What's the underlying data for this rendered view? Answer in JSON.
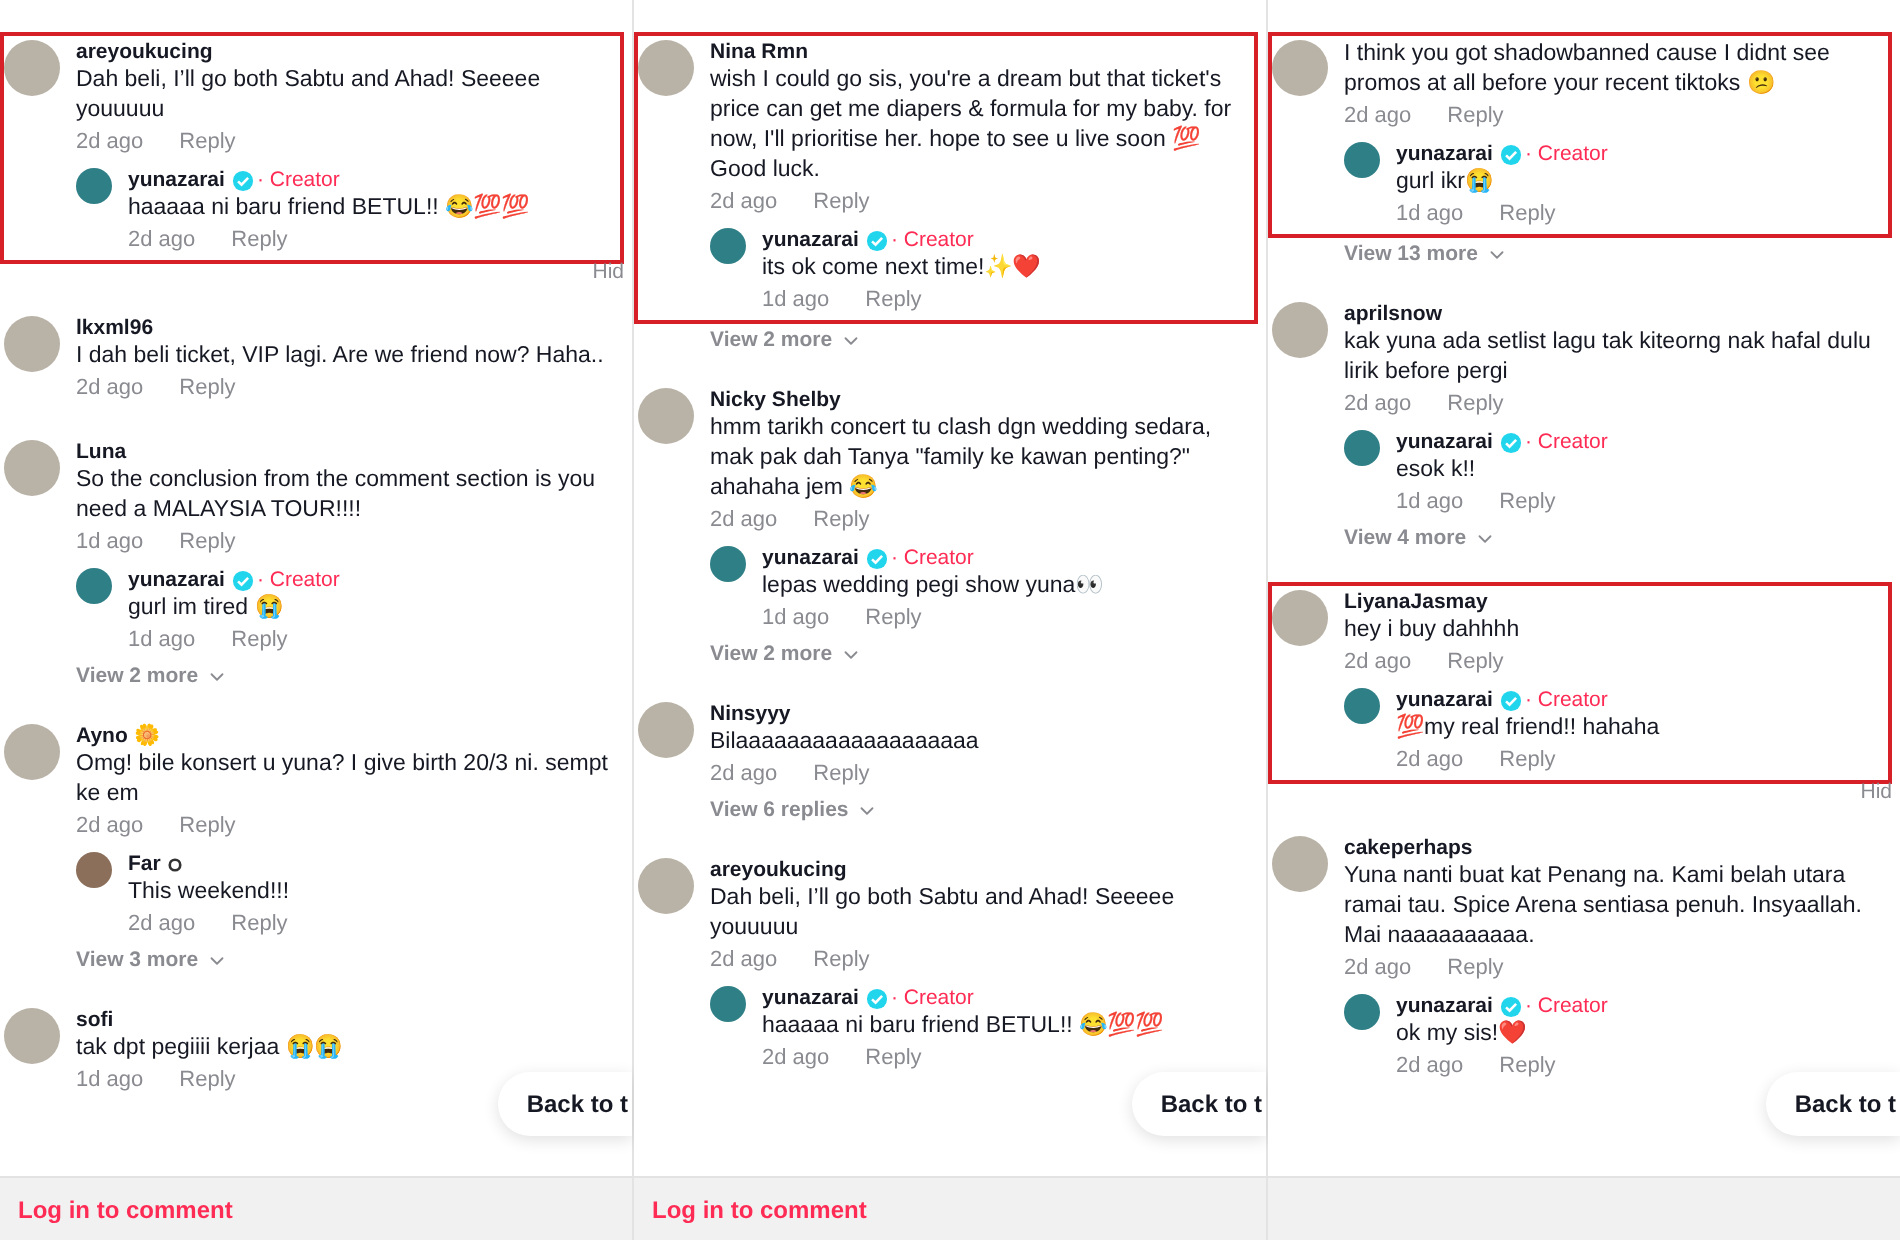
{
  "panels": [
    {
      "items": [
        {
          "user": "areyoukucing",
          "highlighted": true,
          "text": "Dah beli, I’ll go both Sabtu and Ahad! Seeeee youuuuu",
          "time": "2d ago",
          "reply": "Reply",
          "replies": [
            {
              "user": "yunazarai",
              "verified": true,
              "badge": "· Creator",
              "text": "haaaaa ni baru friend BETUL!! 😂💯💯",
              "time": "2d ago",
              "reply": "Reply"
            }
          ],
          "hide": "Hid"
        },
        {
          "user": "lkxml96",
          "highlighted": false,
          "text": "I dah beli ticket, VIP lagi. Are we friend now? Haha..",
          "time": "2d ago",
          "reply": "Reply"
        },
        {
          "user": "Luna",
          "highlighted": false,
          "text": "So the conclusion from the comment section is you need a MALAYSIA TOUR!!!!",
          "time": "1d ago",
          "reply": "Reply",
          "replies": [
            {
              "user": "yunazarai",
              "verified": true,
              "badge": "· Creator",
              "text": "gurl im tired 😭",
              "time": "1d ago",
              "reply": "Reply"
            }
          ],
          "more": "View 2 more"
        },
        {
          "user": "Ayno 🌼",
          "highlighted": false,
          "text": "Omg! bile konsert u yuna? I give birth 20/3 ni. sempt ke em",
          "time": "2d ago",
          "reply": "Reply",
          "replies": [
            {
              "user": "Far",
              "user_icon": true,
              "verified": false,
              "text": "This weekend!!!",
              "time": "2d ago",
              "reply": "Reply"
            }
          ],
          "more": "View 3 more"
        },
        {
          "user": "sofi",
          "highlighted": false,
          "text": "tak dpt pegiiii kerjaa 😭😭",
          "time": "1d ago",
          "reply": "Reply"
        }
      ],
      "back": "Back to t",
      "login": "Log in to comment"
    },
    {
      "items": [
        {
          "user": "Nina Rmn",
          "highlighted": true,
          "text": "wish I could go sis, you're a dream but that ticket's price can get me diapers & formula for my baby. for now, I'll prioritise her. hope to see u live soon 💯 Good luck.",
          "time": "2d ago",
          "reply": "Reply",
          "replies": [
            {
              "user": "yunazarai",
              "verified": true,
              "badge": "· Creator",
              "text": "its ok come next time!✨❤️",
              "time": "1d ago",
              "reply": "Reply"
            }
          ],
          "more": "View 2 more"
        },
        {
          "user": "Nicky Shelby",
          "highlighted": false,
          "text": "hmm tarikh concert tu clash dgn wedding sedara, mak pak dah Tanya \"family ke kawan penting?\" ahahaha jem 😂",
          "time": "2d ago",
          "reply": "Reply",
          "replies": [
            {
              "user": "yunazarai",
              "verified": true,
              "badge": "· Creator",
              "text": "lepas wedding pegi show yuna👀",
              "time": "1d ago",
              "reply": "Reply"
            }
          ],
          "more": "View 2 more"
        },
        {
          "user": "Ninsyyy",
          "highlighted": false,
          "text": "Bilaaaaaaaaaaaaaaaaaaa",
          "time": "2d ago",
          "reply": "Reply",
          "more": "View 6 replies"
        },
        {
          "user": "areyoukucing",
          "highlighted": false,
          "text": "Dah beli, I’ll go both Sabtu and Ahad! Seeeee youuuuu",
          "time": "2d ago",
          "reply": "Reply",
          "replies": [
            {
              "user": "yunazarai",
              "verified": true,
              "badge": "· Creator",
              "text": "haaaaa ni baru friend BETUL!! 😂💯💯",
              "time": "2d ago",
              "reply": "Reply"
            }
          ]
        }
      ],
      "back": "Back to t",
      "login": "Log in to comment"
    },
    {
      "items": [
        {
          "highlighted": true,
          "text": "I think you got shadowbanned cause I didnt see promos at all before your recent tiktoks 😕",
          "time": "2d ago",
          "reply": "Reply",
          "replies": [
            {
              "user": "yunazarai",
              "verified": true,
              "badge": "· Creator",
              "text": "gurl ikr😭",
              "time": "1d ago",
              "reply": "Reply"
            }
          ],
          "more": "View 13 more"
        },
        {
          "user": "aprilsnow",
          "highlighted": false,
          "text": "kak yuna ada setlist lagu tak kiteorng nak hafal dulu lirik before pergi",
          "time": "2d ago",
          "reply": "Reply",
          "replies": [
            {
              "user": "yunazarai",
              "verified": true,
              "badge": "· Creator",
              "text": "esok k!!",
              "time": "1d ago",
              "reply": "Reply"
            }
          ],
          "more": "View 4 more"
        },
        {
          "user": "LiyanaJasmay",
          "highlighted": true,
          "text": "hey i buy dahhhh",
          "time": "2d ago",
          "reply": "Reply",
          "replies": [
            {
              "user": "yunazarai",
              "verified": true,
              "badge": "· Creator",
              "text": "💯my real friend!! hahaha",
              "time": "2d ago",
              "reply": "Reply"
            }
          ],
          "hide": "Hid"
        },
        {
          "user": "cakeperhaps",
          "highlighted": false,
          "text": "Yuna nanti buat kat Penang na. Kami belah utara ramai tau. Spice Arena sentiasa penuh. Insyaallah. Mai naaaaaaaaaa.",
          "time": "2d ago",
          "reply": "Reply",
          "replies": [
            {
              "user": "yunazarai",
              "verified": true,
              "badge": "· Creator",
              "text": "ok my sis!❤️",
              "time": "2d ago",
              "reply": "Reply"
            }
          ]
        }
      ],
      "back": "Back to t"
    }
  ]
}
